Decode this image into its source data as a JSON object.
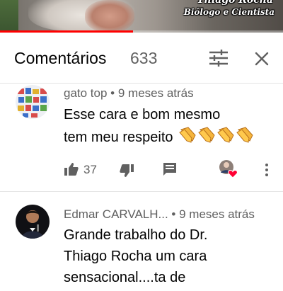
{
  "video": {
    "overlay_name": "Thiago Rocha",
    "overlay_title": "Biólogo e Cientista",
    "progress": 0.47,
    "progress_color": "#ff0000"
  },
  "header": {
    "title": "Comentários",
    "count": "633",
    "sort_icon": "sort-filter-icon",
    "close_icon": "close-icon"
  },
  "comments": [
    {
      "author": "gato top",
      "separator": " • ",
      "time": "9 meses atrás",
      "text_lines": [
        "Esse cara e bom mesmo",
        "tem meu respeito"
      ],
      "emoji": "clapping-hands x4",
      "likes": "37",
      "creator_heart": true
    },
    {
      "author": "Edmar CARVALH...",
      "separator": " • ",
      "time": "9 meses atrás",
      "text_lines": [
        "Grande trabalho do Dr.",
        "Thiago Rocha um cara",
        "sensacional....ta de"
      ]
    }
  ],
  "colors": {
    "primary_text": "#030303",
    "secondary_text": "#606060",
    "divider": "#e5e5e5",
    "heart": "#ff0033"
  }
}
